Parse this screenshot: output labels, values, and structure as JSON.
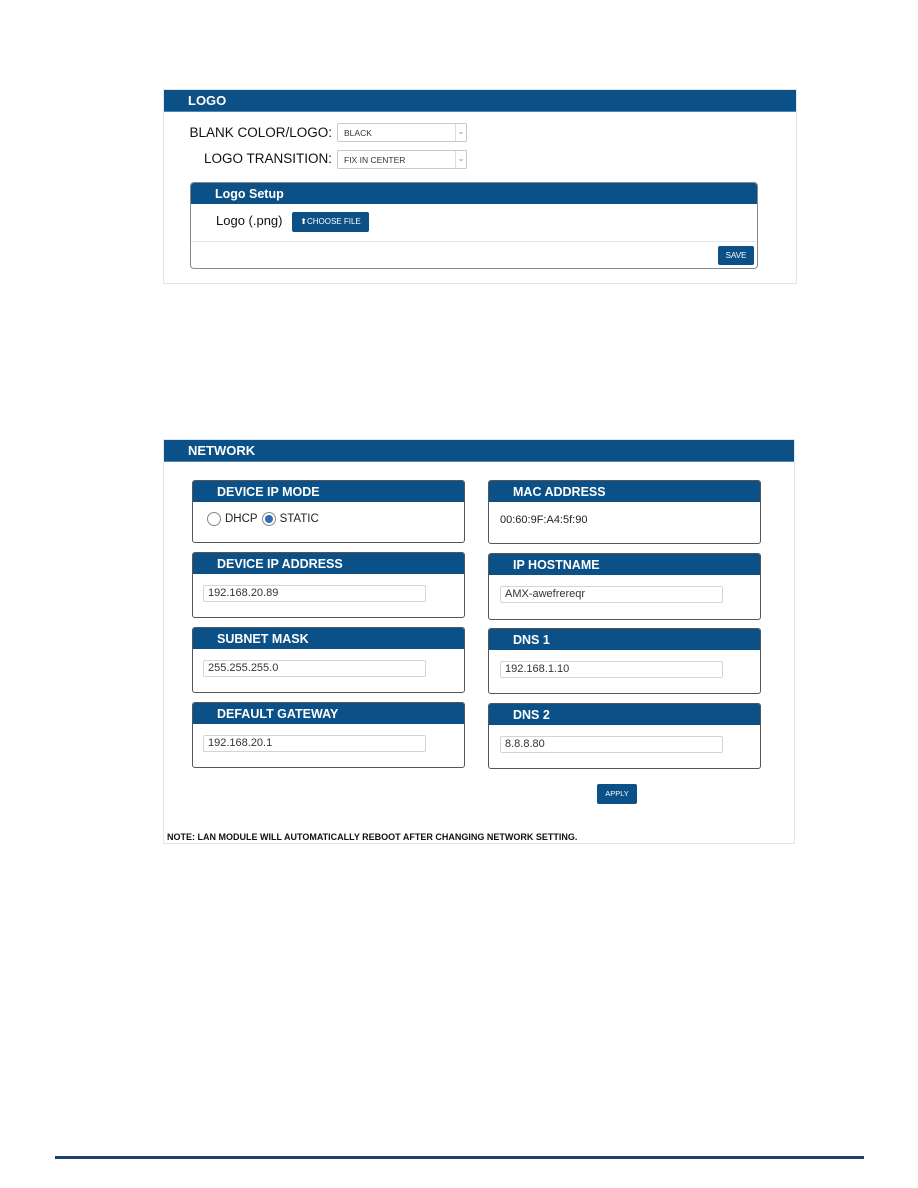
{
  "logo": {
    "title": "LOGO",
    "blank_label": "BLANK COLOR/LOGO:",
    "blank_value": "BLACK",
    "transition_label": "LOGO TRANSITION:",
    "transition_value": "FIX IN CENTER",
    "setup": {
      "title": "Logo Setup",
      "file_label": "Logo (.png)",
      "choose_file": "CHOOSE FILE",
      "save": "SAVE"
    }
  },
  "network": {
    "title": "NETWORK",
    "ip_mode": {
      "title": "DEVICE IP MODE",
      "options": [
        "DHCP",
        "STATIC"
      ],
      "selected": "STATIC"
    },
    "mac": {
      "title": "MAC ADDRESS",
      "value": "00:60:9F:A4:5f:90"
    },
    "ip_address": {
      "title": "DEVICE IP ADDRESS",
      "value": "192.168.20.89"
    },
    "hostname": {
      "title": "IP HOSTNAME",
      "value": "AMX-awefrereqr"
    },
    "subnet": {
      "title": "SUBNET MASK",
      "value": "255.255.255.0"
    },
    "dns1": {
      "title": "DNS 1",
      "value": "192.168.1.10"
    },
    "gateway": {
      "title": "DEFAULT GATEWAY",
      "value": "192.168.20.1"
    },
    "dns2": {
      "title": "DNS 2",
      "value": "8.8.8.80"
    },
    "apply": "APPLY",
    "note": "NOTE: LAN MODULE WILL AUTOMATICALLY REBOOT AFTER CHANGING NETWORK SETTING."
  },
  "colors": {
    "header": "#0b5187",
    "radio": "#2f6db5"
  }
}
